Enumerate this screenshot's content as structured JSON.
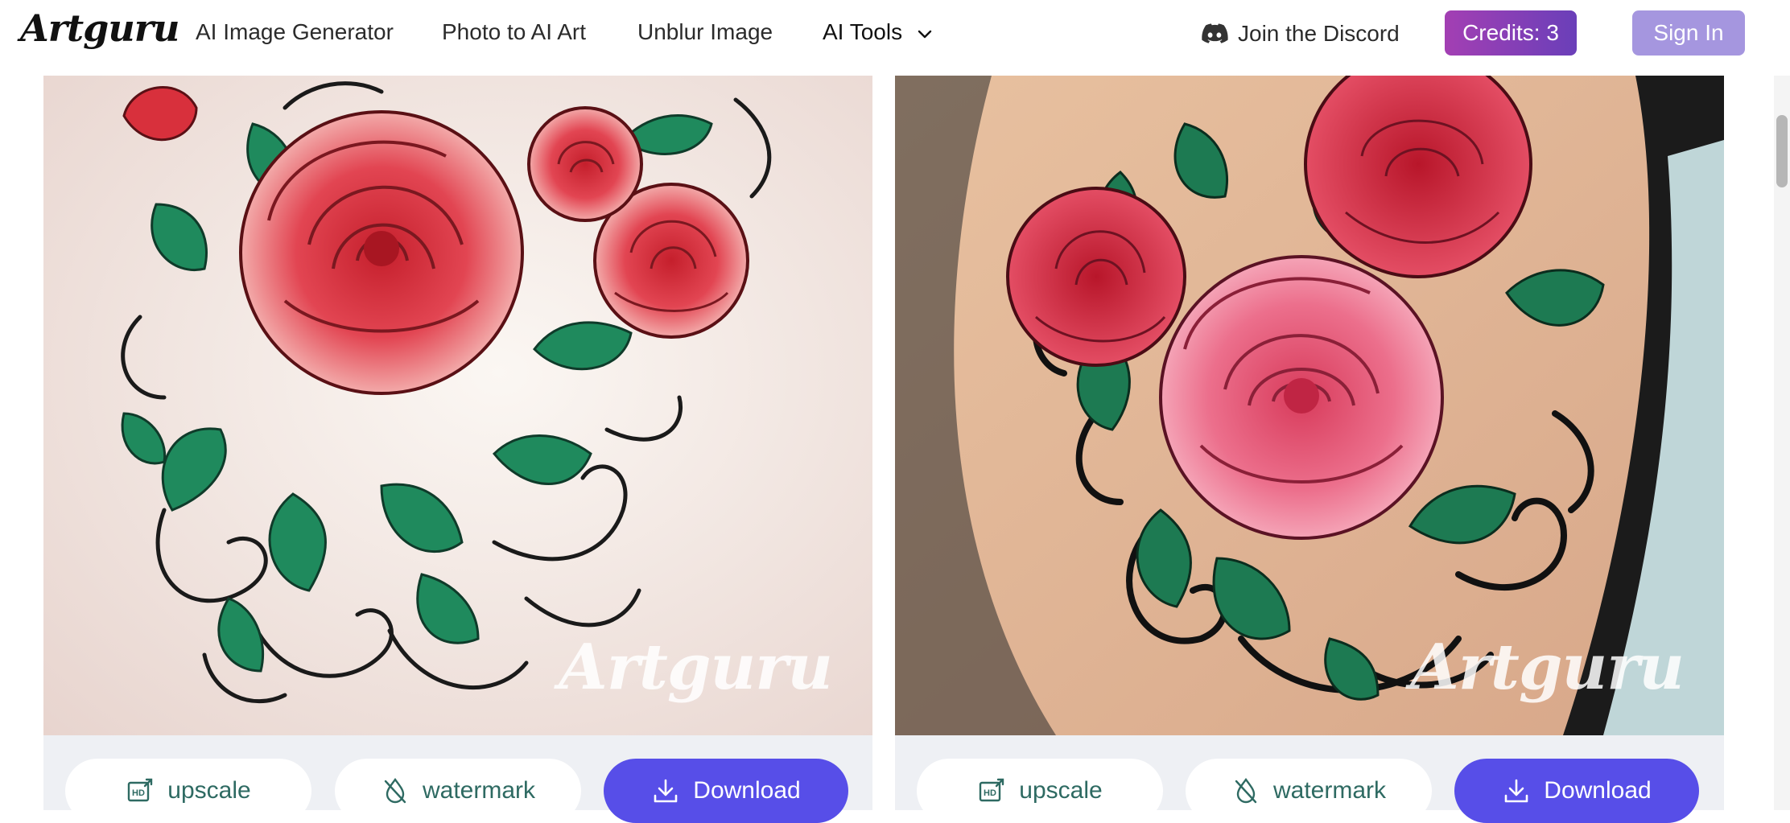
{
  "nav": {
    "logo": "Artguru",
    "links": [
      "AI Image Generator",
      "Photo to AI Art",
      "Unblur Image",
      "AI Tools"
    ],
    "discord": "Join the Discord",
    "credits": "Credits: 3",
    "sign_in": "Sign In"
  },
  "cards": [
    {
      "watermark": "Artguru",
      "upscale": "upscale",
      "watermark_btn": "watermark",
      "download": "Download"
    },
    {
      "watermark": "Artguru",
      "upscale": "upscale",
      "watermark_btn": "watermark",
      "download": "Download"
    }
  ],
  "colors": {
    "accent": "#574ee8",
    "credits": "#8b3fb6",
    "sign_in": "#a596df",
    "teal_text": "#2e6a62"
  }
}
